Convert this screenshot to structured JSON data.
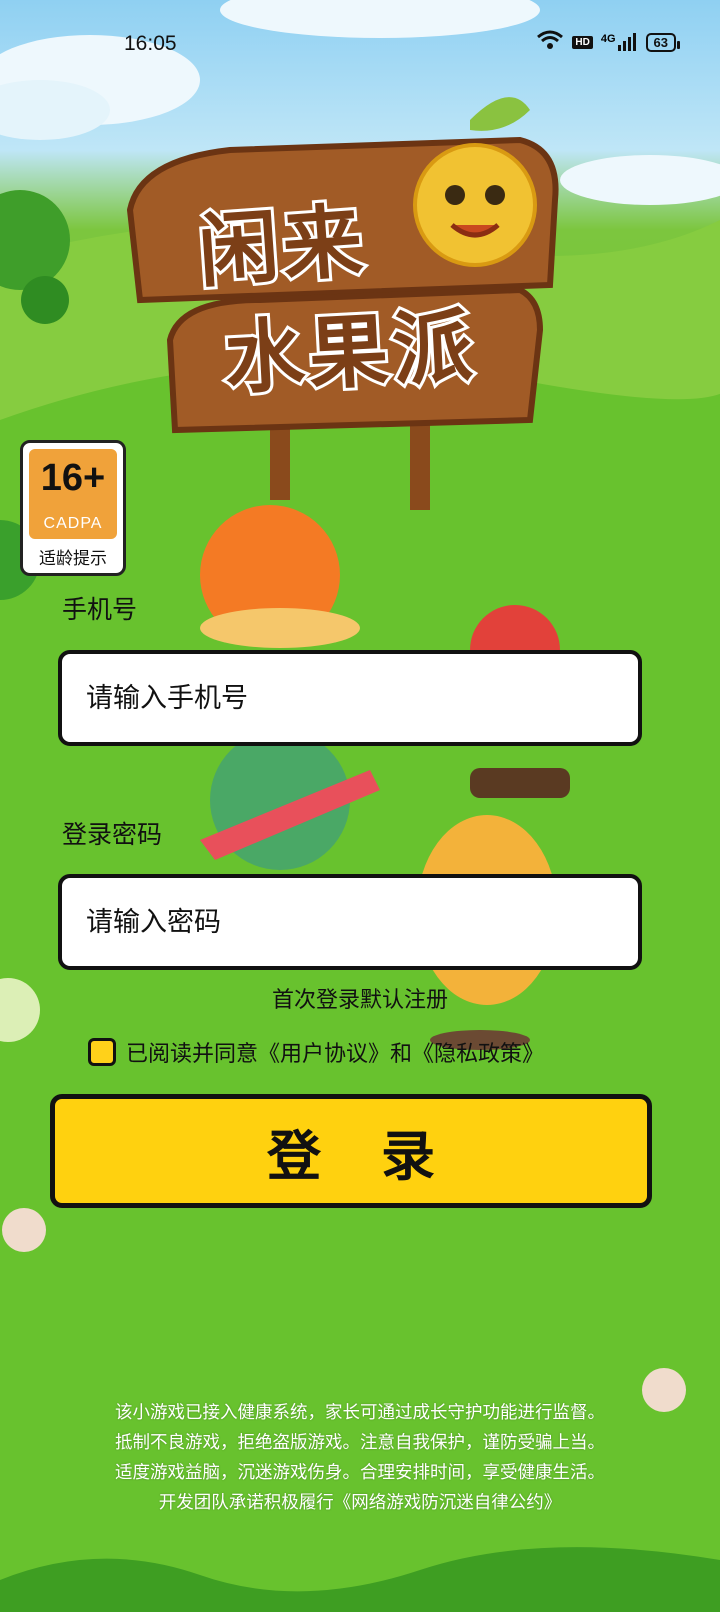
{
  "status": {
    "time": "16:05",
    "hd": "HD",
    "network": "4G",
    "battery": "63"
  },
  "title": {
    "line1": "闲来",
    "line2": "水果派"
  },
  "age_rating": {
    "age": "16+",
    "org": "CADPA",
    "tip": "适龄提示"
  },
  "form": {
    "phone_label": "手机号",
    "phone_placeholder": "请输入手机号",
    "password_label": "登录密码",
    "password_placeholder": "请输入密码",
    "first_login_hint": "首次登录默认注册",
    "agreement_text": "已阅读并同意《用户协议》和《隐私政策》",
    "login_label": "登录"
  },
  "footer": {
    "line1": "该小游戏已接入健康系统，家长可通过成长守护功能进行监督。",
    "line2": "抵制不良游戏，拒绝盗版游戏。注意自我保护，谨防受骗上当。",
    "line3": "适度游戏益脑，沉迷游戏伤身。合理安排时间，享受健康生活。",
    "line4": "开发团队承诺积极履行《网络游戏防沉迷自律公约》"
  },
  "colors": {
    "button_yellow": "#ffd10f",
    "wood": "#8a4a1c",
    "grass": "#5cbf24"
  }
}
